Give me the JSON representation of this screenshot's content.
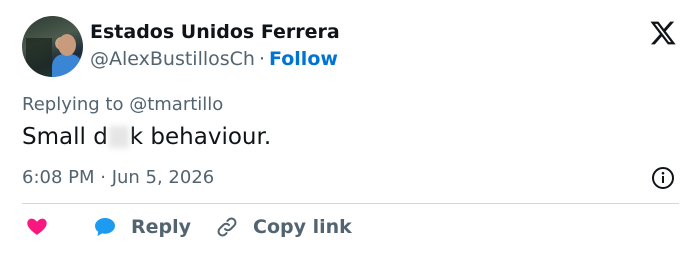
{
  "author": {
    "display_name": "Estados Unidos Ferrera",
    "handle": "@AlexBustillosCh",
    "separator": "·",
    "follow_label": "Follow"
  },
  "tweet": {
    "reply_to": "Replying to @tmartillo",
    "text_before": "Small d",
    "text_after": "k behaviour.",
    "timestamp": "6:08 PM · Jun 5, 2026"
  },
  "actions": {
    "reply_label": "Reply",
    "copy_link_label": "Copy link"
  },
  "colors": {
    "link": "#0074d4",
    "secondary_text": "#536471",
    "like_heart": "#f91880",
    "reply_bubble": "#1d9bf0"
  },
  "icons": [
    "x-logo-icon",
    "info-icon",
    "heart-icon",
    "reply-bubble-icon",
    "link-icon"
  ]
}
